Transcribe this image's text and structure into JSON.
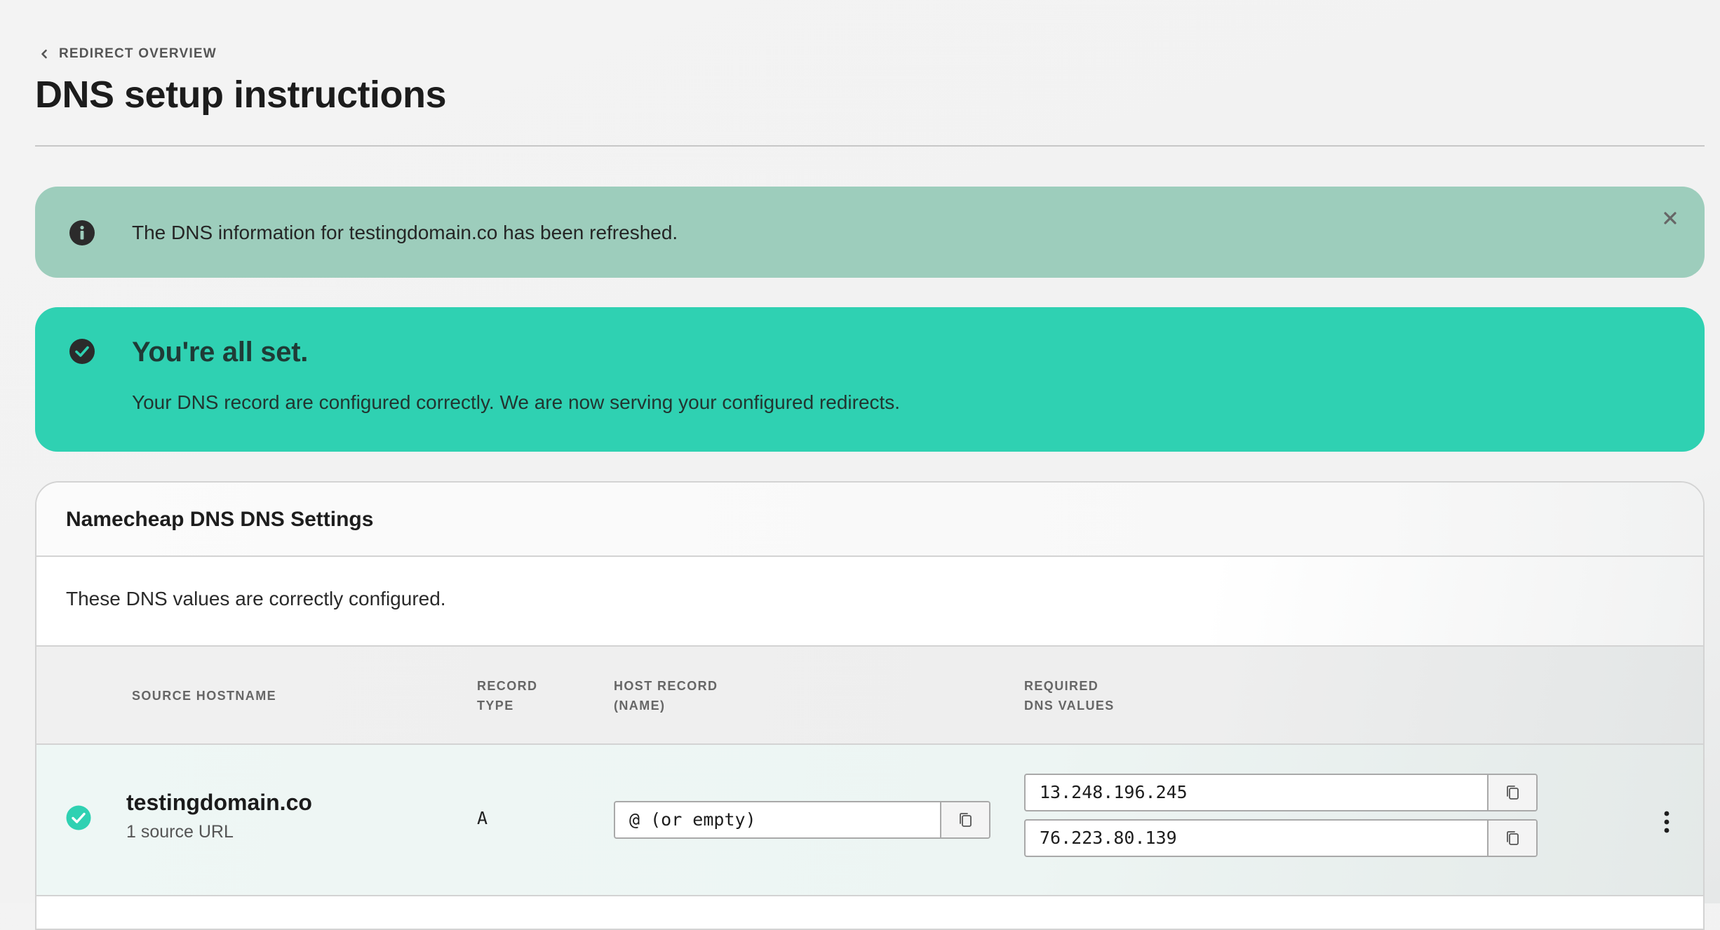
{
  "breadcrumb": {
    "label": "REDIRECT OVERVIEW"
  },
  "page": {
    "title": "DNS setup instructions"
  },
  "notice": {
    "message": "The DNS information for testingdomain.co has been refreshed.",
    "icon": "info-icon",
    "color": "#9dcdbc"
  },
  "success": {
    "title": "You're all set.",
    "message": "Your DNS record are configured correctly. We are now serving your configured redirects.",
    "icon": "check-circle-icon",
    "color": "#2fd1b2"
  },
  "panel": {
    "title": "Namecheap DNS DNS Settings",
    "status_message": "These DNS values are correctly configured.",
    "columns": {
      "source_hostname": "SOURCE HOSTNAME",
      "record_type_1": "RECORD",
      "record_type_2": "TYPE",
      "host_record_1": "HOST RECORD",
      "host_record_2": "(NAME)",
      "required_values_1": "REQUIRED",
      "required_values_2": "DNS VALUES"
    },
    "rows": [
      {
        "hostname": "testingdomain.co",
        "source_count": "1 source URL",
        "record_type": "A",
        "host_record": "@ (or empty)",
        "dns_values": [
          "13.248.196.245",
          "76.223.80.139"
        ],
        "status_icon": "check-circle-icon",
        "status_color": "#2fd1b2"
      }
    ]
  }
}
